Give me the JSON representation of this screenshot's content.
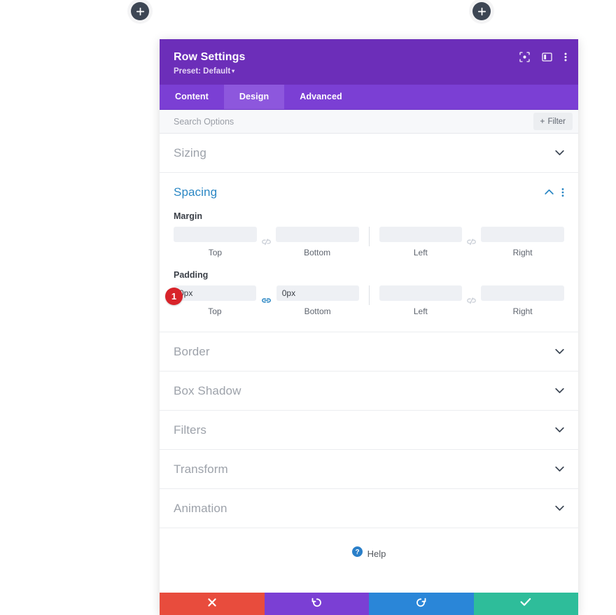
{
  "canvas": {
    "add_buttons": [
      {
        "name": "add-section-left",
        "icon": "plus-icon"
      },
      {
        "name": "add-section-right",
        "icon": "plus-icon"
      }
    ]
  },
  "modal": {
    "title": "Row Settings",
    "preset_label": "Preset: Default",
    "preset_caret": "▾",
    "header_icons": [
      {
        "name": "focus-icon",
        "label": "focus"
      },
      {
        "name": "layout-panel-icon",
        "label": "layout"
      },
      {
        "name": "kebab-menu-icon",
        "label": "more options"
      }
    ],
    "tabs": [
      {
        "label": "Content",
        "active": false
      },
      {
        "label": "Design",
        "active": true
      },
      {
        "label": "Advanced",
        "active": false
      }
    ],
    "search": {
      "placeholder": "Search Options",
      "value": ""
    },
    "filter_button": {
      "plus": "+",
      "label": "Filter"
    },
    "sections": [
      {
        "title": "Sizing",
        "open": false,
        "chevron": "chevron-down-icon"
      },
      {
        "title": "Spacing",
        "open": true,
        "chevron": "chevron-up-icon"
      },
      {
        "title": "Border",
        "open": false,
        "chevron": "chevron-down-icon"
      },
      {
        "title": "Box Shadow",
        "open": false,
        "chevron": "chevron-down-icon"
      },
      {
        "title": "Filters",
        "open": false,
        "chevron": "chevron-down-icon"
      },
      {
        "title": "Transform",
        "open": false,
        "chevron": "chevron-down-icon"
      },
      {
        "title": "Animation",
        "open": false,
        "chevron": "chevron-down-icon"
      }
    ],
    "spacing": {
      "margin": {
        "label": "Margin",
        "top": {
          "value": "",
          "sub": "Top"
        },
        "bottom": {
          "value": "",
          "sub": "Bottom"
        },
        "left": {
          "value": "",
          "sub": "Left"
        },
        "right": {
          "value": "",
          "sub": "Right"
        },
        "link_top_bottom": "unlinked",
        "link_left_right": "unlinked"
      },
      "padding": {
        "label": "Padding",
        "badge": "1",
        "top": {
          "value": "0px",
          "sub": "Top"
        },
        "bottom": {
          "value": "0px",
          "sub": "Bottom"
        },
        "left": {
          "value": "",
          "sub": "Left"
        },
        "right": {
          "value": "",
          "sub": "Right"
        },
        "link_top_bottom": "linked",
        "link_left_right": "unlinked"
      }
    },
    "help": {
      "label": "Help",
      "icon": "question-circle-icon"
    },
    "footer_buttons": [
      {
        "name": "cancel-button",
        "icon": "close-icon",
        "color": "#e84c3d"
      },
      {
        "name": "undo-button",
        "icon": "undo-icon",
        "color": "#7b3fd4"
      },
      {
        "name": "redo-button",
        "icon": "redo-icon",
        "color": "#2a86d8"
      },
      {
        "name": "save-button",
        "icon": "check-icon",
        "color": "#2ebd9a"
      }
    ]
  },
  "colors": {
    "header_purple": "#6c2eb9",
    "tab_purple": "#7b3fd4",
    "tab_active_purple": "#8d57dd",
    "accent_blue": "#2b87c4",
    "badge_red": "#d8232a"
  }
}
